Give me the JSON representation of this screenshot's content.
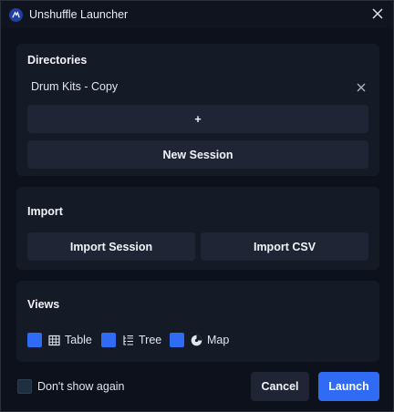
{
  "window": {
    "title": "Unshuffle Launcher",
    "app_icon": "app-logo-icon",
    "close_icon": "close-icon"
  },
  "directories": {
    "heading": "Directories",
    "items": [
      {
        "label": "Drum Kits - Copy",
        "remove_icon": "close-icon"
      }
    ],
    "add_label": "+",
    "new_session_label": "New Session"
  },
  "import": {
    "heading": "Import",
    "import_session_label": "Import Session",
    "import_csv_label": "Import CSV"
  },
  "views": {
    "heading": "Views",
    "items": [
      {
        "label": "Table",
        "icon": "table-icon",
        "checked": true
      },
      {
        "label": "Tree",
        "icon": "tree-icon",
        "checked": true
      },
      {
        "label": "Map",
        "icon": "map-icon",
        "checked": true
      }
    ]
  },
  "footer": {
    "dont_show_label": "Don't show again",
    "dont_show_checked": false,
    "cancel_label": "Cancel",
    "launch_label": "Launch"
  },
  "colors": {
    "accent": "#2f6bf5",
    "background": "#0d111b",
    "panel": "#151a27",
    "button": "#1f2535"
  }
}
